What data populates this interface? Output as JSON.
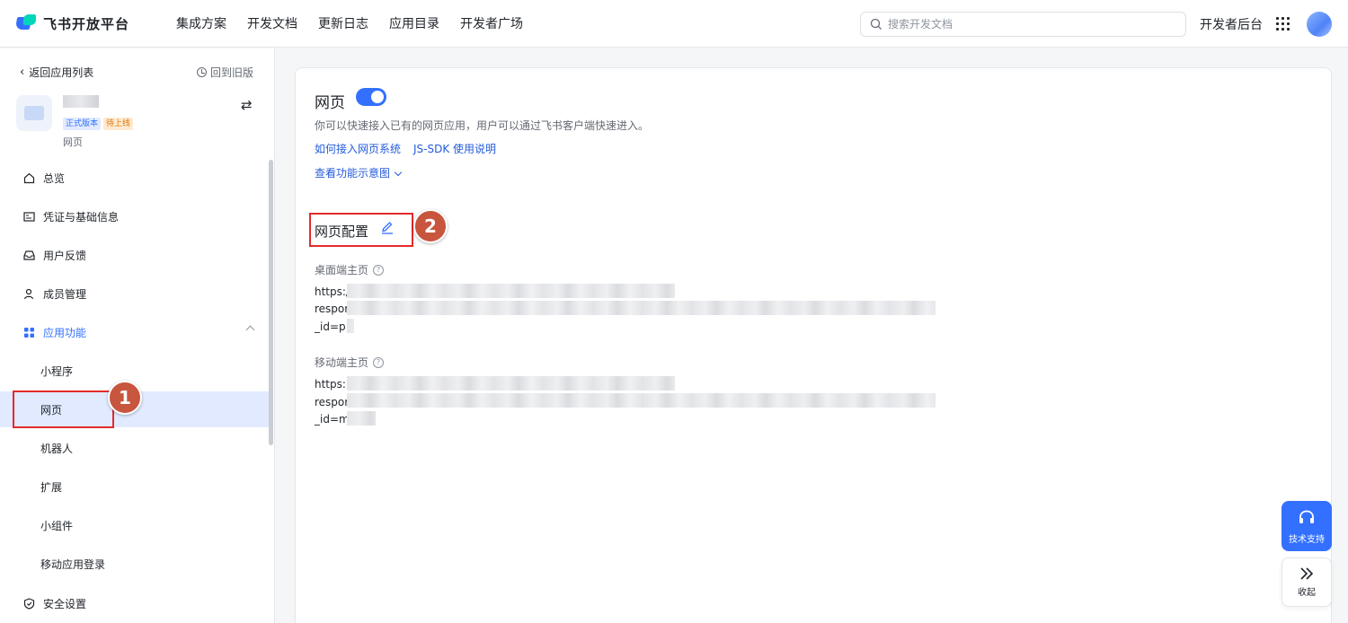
{
  "brand": {
    "name": "飞书开放平台"
  },
  "nav": [
    "集成方案",
    "开发文档",
    "更新日志",
    "应用目录",
    "开发者广场"
  ],
  "search": {
    "placeholder": "搜索开发文档"
  },
  "header": {
    "dev_console": "开发者后台"
  },
  "sidebar": {
    "back": "返回应用列表",
    "old_version": "回到旧版",
    "app": {
      "badge_official": "正式版本",
      "badge_pending": "待上线",
      "type": "网页"
    },
    "menu": {
      "overview": "总览",
      "credentials": "凭证与基础信息",
      "feedback": "用户反馈",
      "members": "成员管理",
      "features": "应用功能",
      "features_sub": [
        "小程序",
        "网页",
        "机器人",
        "扩展",
        "小组件",
        "移动应用登录"
      ],
      "security": "安全设置"
    }
  },
  "main": {
    "title": "网页",
    "toggle_on": true,
    "description": "你可以快速接入已有的网页应用，用户可以通过飞书客户端快速进入。",
    "links": [
      "如何接入网页系统",
      "JS-SDK 使用说明"
    ],
    "view_diagram": "查看功能示意图",
    "config_title": "网页配置",
    "desktop_label": "桌面端主页",
    "desktop_lines": [
      "https:/",
      "respor",
      "_id=p"
    ],
    "mobile_label": "移动端主页",
    "mobile_lines": [
      "https:",
      "respor",
      "_id=m"
    ]
  },
  "annotations": [
    "1",
    "2"
  ],
  "float": {
    "support": "技术支持",
    "collapse": "收起"
  },
  "colors": {
    "accent": "#3370ff",
    "annotation": "#e32a2a"
  }
}
